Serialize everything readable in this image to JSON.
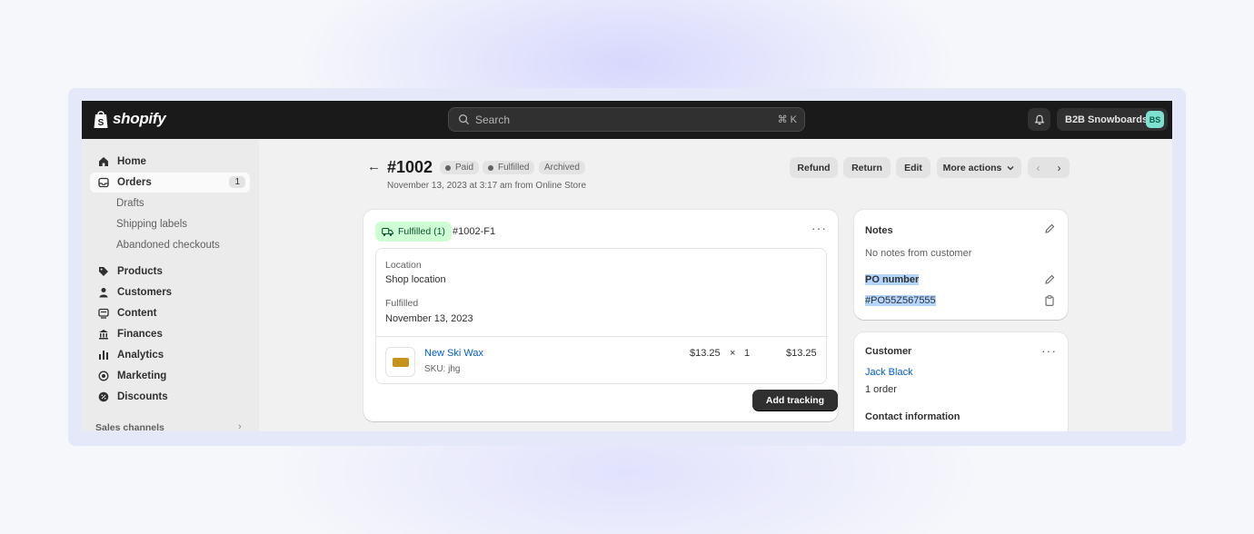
{
  "brand": {
    "name": "shopify"
  },
  "search": {
    "placeholder": "Search",
    "shortcut": "⌘ K"
  },
  "store": {
    "name": "B2B Snowboards",
    "initials": "BS"
  },
  "sidebar": {
    "items": [
      {
        "label": "Home",
        "icon": "home-icon"
      },
      {
        "label": "Orders",
        "icon": "orders-icon",
        "count": "1"
      },
      {
        "label": "Products",
        "icon": "tag-icon"
      },
      {
        "label": "Customers",
        "icon": "person-icon"
      },
      {
        "label": "Content",
        "icon": "content-icon"
      },
      {
        "label": "Finances",
        "icon": "bank-icon"
      },
      {
        "label": "Analytics",
        "icon": "bar-chart-icon"
      },
      {
        "label": "Marketing",
        "icon": "target-icon"
      },
      {
        "label": "Discounts",
        "icon": "discount-icon"
      }
    ],
    "orders_sub": [
      "Drafts",
      "Shipping labels",
      "Abandoned checkouts"
    ],
    "sales_channels": "Sales channels"
  },
  "order": {
    "title": "#1002",
    "badges": [
      "Paid",
      "Fulfilled",
      "Archived"
    ],
    "subtitle": "November 13, 2023 at 3:17 am from Online Store"
  },
  "actions": {
    "refund": "Refund",
    "return": "Return",
    "edit": "Edit",
    "more": "More actions"
  },
  "fulfillment": {
    "status": "Fulfilled (1)",
    "id": "#1002-F1",
    "location_label": "Location",
    "location_value": "Shop location",
    "fulfilled_label": "Fulfilled",
    "fulfilled_value": "November 13, 2023",
    "item": {
      "name": "New Ski Wax",
      "sku": "SKU: jhg",
      "unit_price": "$13.25",
      "times": "×",
      "quantity": "1",
      "total": "$13.25"
    },
    "add_tracking": "Add tracking"
  },
  "notes": {
    "title": "Notes",
    "text": "No notes from customer",
    "po_label": "PO number",
    "po_value": "#PO55Z567555"
  },
  "customer": {
    "title": "Customer",
    "name": "Jack Black",
    "orders": "1 order",
    "contact_title": "Contact information"
  },
  "colors": {
    "topbar": "#1a1a1a",
    "fulfilled_badge_bg": "#cdfed4",
    "link": "#005bd3",
    "highlight": "#b4d5fe",
    "avatar": "#7ee0cf"
  }
}
